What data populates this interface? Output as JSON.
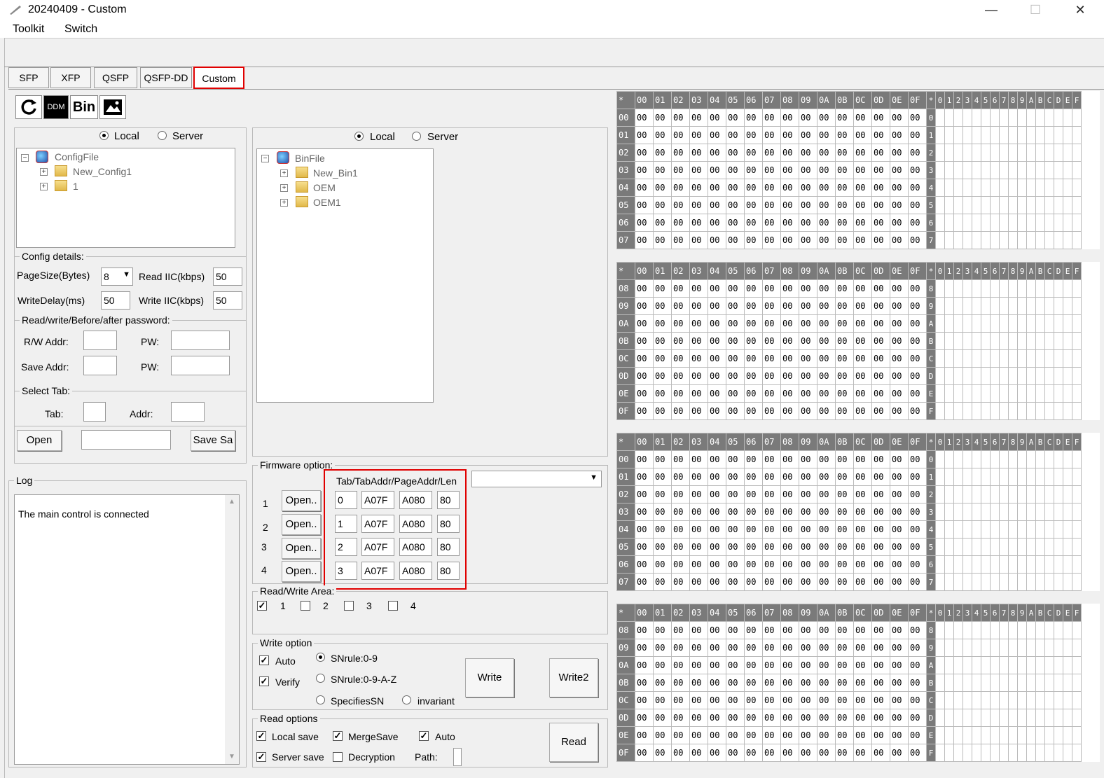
{
  "window": {
    "title": "20240409  - Custom"
  },
  "menu": [
    "Toolkit",
    "Switch"
  ],
  "tabs": [
    "SFP",
    "XFP",
    "QSFP",
    "QSFP-DD",
    "Custom"
  ],
  "toolbar": {
    "refresh_icon": "refresh-icon",
    "ddm_label": "DDM",
    "bin_label": "Bin",
    "image_icon": "image-icon"
  },
  "config_source": {
    "local": "Local",
    "server": "Server",
    "selected": "Local"
  },
  "config_tree": {
    "root": "ConfigFile",
    "children": [
      "New_Config1",
      "1"
    ]
  },
  "config_details": {
    "group_label": "Config details:",
    "pagesize_label": "PageSize(Bytes)",
    "pagesize_value": "8",
    "read_iic_label": "Read IIC(kbps)",
    "read_iic_value": "50",
    "write_delay_label": "WriteDelay(ms)",
    "write_delay_value": "50",
    "write_iic_label": "Write IIC(kbps)",
    "write_iic_value": "50"
  },
  "password": {
    "group_label": "Read/write/Before/after password:",
    "rw_addr_label": "R/W Addr:",
    "pw_label": "PW:",
    "save_addr_label": "Save Addr:",
    "pw2_label": "PW:"
  },
  "select_tab": {
    "group_label": "Select Tab:",
    "tab_label": "Tab:",
    "addr_label": "Addr:"
  },
  "file_buttons": {
    "open": "Open",
    "save": "Save Sa"
  },
  "log": {
    "label": "Log",
    "text": "The main control is connected"
  },
  "bin_source": {
    "local": "Local",
    "server": "Server",
    "selected": "Local"
  },
  "bin_tree": {
    "root": "BinFile",
    "children": [
      "New_Bin1",
      "OEM",
      "OEM1"
    ]
  },
  "firmware": {
    "group_label": "Firmware option:",
    "header": "Tab/TabAddr/PageAddr/Len",
    "rows": [
      {
        "num": "1",
        "open": "Open..",
        "tab": "0",
        "tabaddr": "A07F",
        "pageaddr": "A080",
        "len": "80"
      },
      {
        "num": "2",
        "open": "Open..",
        "tab": "1",
        "tabaddr": "A07F",
        "pageaddr": "A080",
        "len": "80"
      },
      {
        "num": "3",
        "open": "Open..",
        "tab": "2",
        "tabaddr": "A07F",
        "pageaddr": "A080",
        "len": "80"
      },
      {
        "num": "4",
        "open": "Open..",
        "tab": "3",
        "tabaddr": "A07F",
        "pageaddr": "A080",
        "len": "80"
      }
    ]
  },
  "rw_area": {
    "group_label": "Read/Write Area:",
    "items": [
      {
        "label": "1",
        "checked": true
      },
      {
        "label": "2",
        "checked": false
      },
      {
        "label": "3",
        "checked": false
      },
      {
        "label": "4",
        "checked": false
      }
    ]
  },
  "write_option": {
    "group_label": "Write option",
    "auto": "Auto",
    "verify": "Verify",
    "sn1": "SNrule:0-9",
    "sn2": "SNrule:0-9-A-Z",
    "sn3": "SpecifiesSN",
    "sn4": "invariant",
    "write": "Write",
    "write2": "Write2"
  },
  "read_options": {
    "group_label": "Read options",
    "local_save": "Local save",
    "merge_save": "MergeSave",
    "auto": "Auto",
    "server_save": "Server save",
    "decryption": "Decryption",
    "path": "Path:",
    "read": "Read"
  },
  "hex": {
    "corner": "*",
    "columns": [
      "00",
      "01",
      "02",
      "03",
      "04",
      "05",
      "06",
      "07",
      "08",
      "09",
      "0A",
      "0B",
      "0C",
      "0D",
      "0E",
      "0F"
    ],
    "ascii_header": [
      "*",
      "0",
      "1",
      "2",
      "3",
      "4",
      "5",
      "6",
      "7",
      "8",
      "9",
      "A",
      "B",
      "C",
      "D",
      "E",
      "F"
    ],
    "cell_value": "00",
    "blocks": [
      [
        "00",
        "01",
        "02",
        "03",
        "04",
        "05",
        "06",
        "07"
      ],
      [
        "08",
        "09",
        "0A",
        "0B",
        "0C",
        "0D",
        "0E",
        "0F"
      ],
      [
        "00",
        "01",
        "02",
        "03",
        "04",
        "05",
        "06",
        "07"
      ],
      [
        "08",
        "09",
        "0A",
        "0B",
        "0C",
        "0D",
        "0E",
        "0F"
      ]
    ],
    "ascii_first": [
      [
        "0",
        "1",
        "2",
        "3",
        "4",
        "5",
        "6",
        "7"
      ],
      [
        "8",
        "9",
        "A",
        "B",
        "C",
        "D",
        "E",
        "F"
      ],
      [
        "0",
        "1",
        "2",
        "3",
        "4",
        "5",
        "6",
        "7"
      ],
      [
        "8",
        "9",
        "A",
        "B",
        "C",
        "D",
        "E",
        "F"
      ]
    ]
  }
}
